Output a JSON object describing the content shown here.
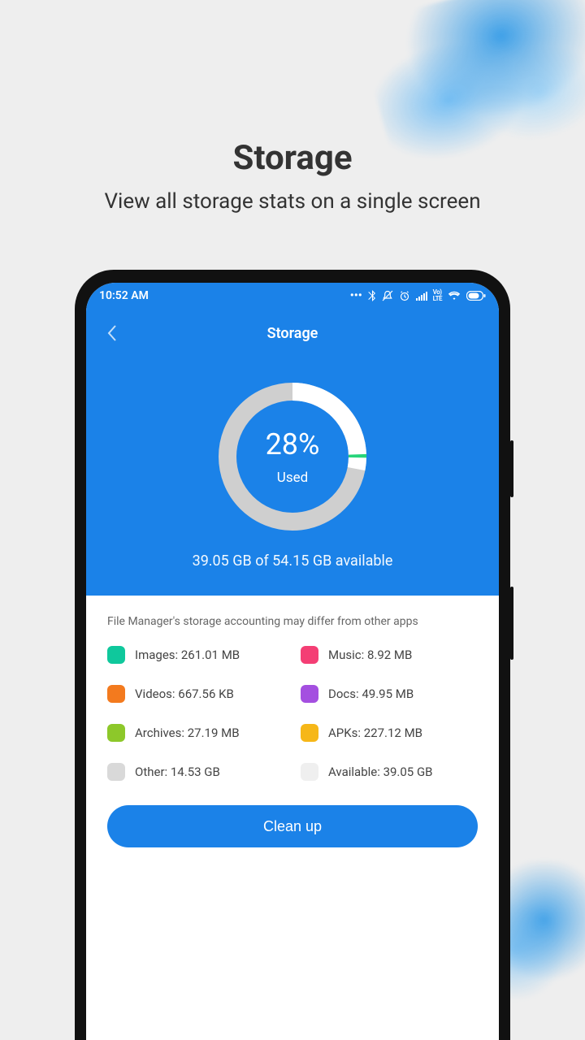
{
  "promo": {
    "title": "Storage",
    "subtitle": "View all storage stats on a single screen"
  },
  "statusbar": {
    "time": "10:52 AM"
  },
  "header": {
    "title": "Storage"
  },
  "usage": {
    "percent": "28%",
    "percent_value": 28,
    "label": "Used",
    "available_text": "39.05 GB of 54.15 GB available"
  },
  "note": "File Manager's storage accounting may differ from other apps",
  "categories": [
    {
      "label": "Images: 261.01 MB",
      "color": "#0fc89c"
    },
    {
      "label": "Music: 8.92 MB",
      "color": "#f43e74"
    },
    {
      "label": "Videos: 667.56 KB",
      "color": "#f37a1e"
    },
    {
      "label": "Docs: 49.95 MB",
      "color": "#a44fe0"
    },
    {
      "label": "Archives: 27.19 MB",
      "color": "#8dc82a"
    },
    {
      "label": "APKs: 227.12 MB",
      "color": "#f6b718"
    },
    {
      "label": "Other: 14.53 GB",
      "color": "#d9d9d9"
    },
    {
      "label": "Available: 39.05 GB",
      "color": "#efefef"
    }
  ],
  "cleanup_label": "Clean up",
  "chart_data": {
    "type": "pie",
    "title": "Storage used",
    "series": [
      {
        "name": "Used",
        "value": 28
      },
      {
        "name": "Available",
        "value": 72
      }
    ],
    "center_label": "28% Used"
  }
}
